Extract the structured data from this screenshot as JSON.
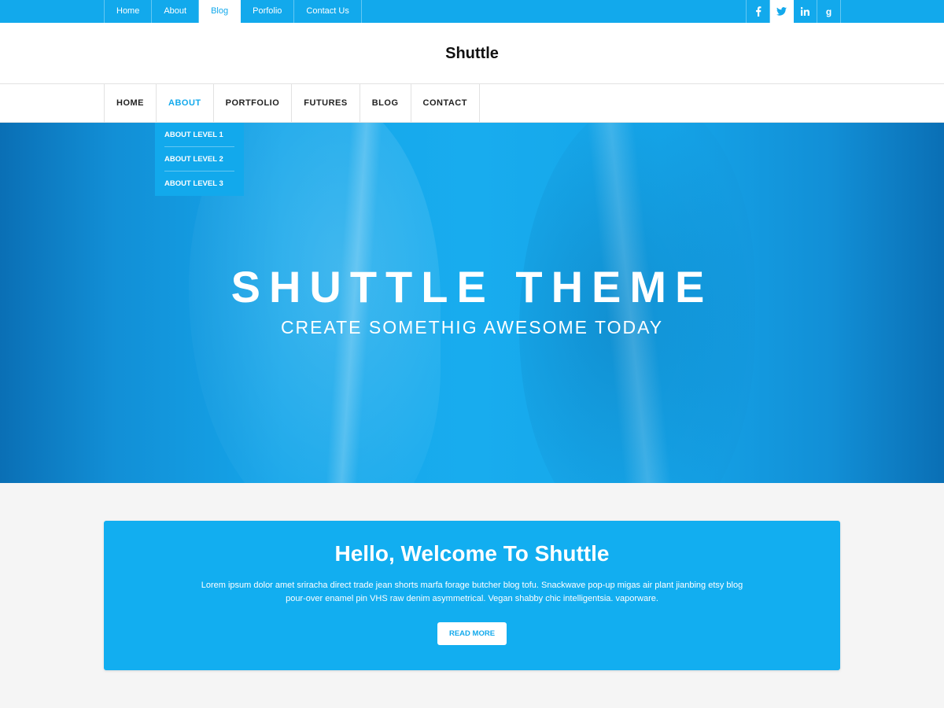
{
  "topbar": {
    "links": [
      "Home",
      "About",
      "Blog",
      "Porfolio",
      "Contact Us"
    ],
    "active_link": "Blog",
    "social": [
      {
        "icon": "facebook-icon",
        "glyph": "f"
      },
      {
        "icon": "twitter-icon",
        "glyph": "t"
      },
      {
        "icon": "linkedin-icon",
        "glyph": "in"
      },
      {
        "icon": "google-icon",
        "glyph": "g"
      }
    ]
  },
  "header": {
    "site_title": "Shuttle"
  },
  "mainnav": {
    "items": [
      "HOME",
      "ABOUT",
      "PORTFOLIO",
      "FUTURES",
      "BLOG",
      "CONTACT"
    ],
    "active": "ABOUT",
    "dropdown": [
      "ABOUT LEVEL 1",
      "ABOUT LEVEL 2",
      "ABOUT LEVEL 3"
    ]
  },
  "hero": {
    "title": "SHUTTLE THEME",
    "subtitle": "CREATE SOMETHIG AWESOME TODAY"
  },
  "welcome": {
    "heading": "Hello, Welcome To Shuttle",
    "text": "Lorem ipsum dolor amet sriracha direct trade jean shorts marfa forage butcher blog tofu. Snackwave pop-up migas air plant  jianbing etsy blog pour-over enamel pin VHS raw denim asymmetrical. Vegan shabby chic intelligentsia. vaporware.",
    "button": "READ MORE"
  },
  "colors": {
    "accent": "#12a9ec",
    "background": "#f5f5f5"
  }
}
